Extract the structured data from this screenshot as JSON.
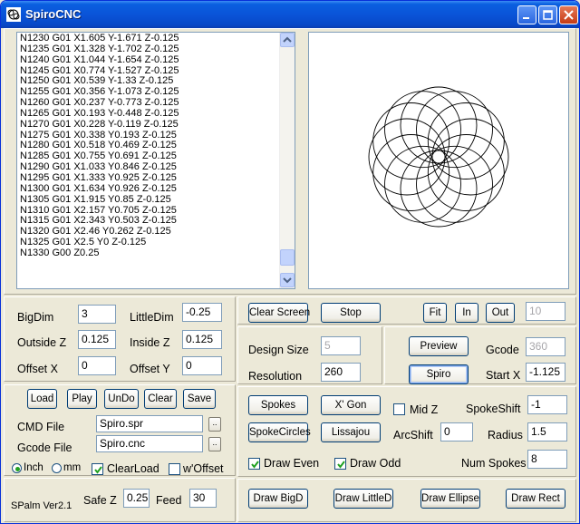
{
  "window": {
    "title": "SpiroCNC"
  },
  "gcode_lines": [
    "N1230 G01 X1.605 Y-1.671 Z-0.125",
    "N1235 G01 X1.328 Y-1.702 Z-0.125",
    "N1240 G01 X1.044 Y-1.654 Z-0.125",
    "N1245 G01 X0.774 Y-1.527 Z-0.125",
    "N1250 G01 X0.539 Y-1.33 Z-0.125",
    "N1255 G01 X0.356 Y-1.073 Z-0.125",
    "N1260 G01 X0.237 Y-0.773 Z-0.125",
    "N1265 G01 X0.193 Y-0.448 Z-0.125",
    "N1270 G01 X0.228 Y-0.119 Z-0.125",
    "N1275 G01 X0.338 Y0.193 Z-0.125",
    "N1280 G01 X0.518 Y0.469 Z-0.125",
    "N1285 G01 X0.755 Y0.691 Z-0.125",
    "N1290 G01 X1.033 Y0.846 Z-0.125",
    "N1295 G01 X1.333 Y0.925 Z-0.125",
    "N1300 G01 X1.634 Y0.926 Z-0.125",
    "N1305 G01 X1.915 Y0.85 Z-0.125",
    "N1310 G01 X2.157 Y0.705 Z-0.125",
    "N1315 G01 X2.343 Y0.503 Z-0.125",
    "N1320 G01 X2.46 Y0.262 Z-0.125",
    "N1325 G01 X2.5 Y0 Z-0.125",
    "N1330 G00 Z0.25"
  ],
  "dims": {
    "bigdim_label": "BigDim",
    "bigdim_value": "3",
    "littledim_label": "LittleDim",
    "littledim_value": "-0.25",
    "outsidez_label": "Outside Z",
    "outsidez_value": "0.125",
    "insidez_label": "Inside Z",
    "insidez_value": "0.125",
    "offsetx_label": "Offset X",
    "offsetx_value": "0",
    "offsety_label": "Offset Y",
    "offsety_value": "0"
  },
  "file_panel": {
    "load": "Load",
    "play": "Play",
    "undo": "UnDo",
    "clear": "Clear",
    "save": "Save",
    "cmd_file_label": "CMD File",
    "cmd_file_value": "Spiro.spr",
    "gcode_file_label": "Gcode File",
    "gcode_file_value": "Spiro.cnc",
    "browse": "..",
    "inch": "Inch",
    "mm": "mm",
    "clearload": "ClearLoad",
    "woffset": "w'Offset",
    "units_selected": "Inch"
  },
  "status": {
    "version": "SPalm Ver2.1",
    "safez_label": "Safe Z",
    "safez_value": "0.25",
    "feed_label": "Feed",
    "feed_value": "30"
  },
  "toolbar": {
    "clear_screen": "Clear Screen",
    "stop": "Stop",
    "fit": "Fit",
    "in": "In",
    "out": "Out",
    "zoom_value": "10"
  },
  "design": {
    "design_size_label": "Design Size",
    "design_size_value": "5",
    "resolution_label": "Resolution",
    "resolution_value": "260",
    "preview": "Preview",
    "spiro": "Spiro",
    "gcode_label": "Gcode",
    "gcode_value": "360",
    "startx_label": "Start X",
    "startx_value": "-1.125"
  },
  "shapes": {
    "spokes": "Spokes",
    "xgon": "X' Gon",
    "midz": "Mid Z",
    "spokeshift_label": "SpokeShift",
    "spokeshift_value": "-1",
    "spokecircles": "SpokeCircles",
    "lissajou": "Lissajou",
    "arcshift_label": "ArcShift",
    "arcshift_value": "0",
    "radius_label": "Radius",
    "radius_value": "1.5",
    "draw_even": "Draw Even",
    "draw_odd": "Draw Odd",
    "numspokes_label": "Num Spokes",
    "numspokes_value": "8"
  },
  "draw_buttons": {
    "bigd": "Draw BigD",
    "littled": "Draw LittleD",
    "ellipse": "Draw Ellipse",
    "rect": "Draw Rect"
  },
  "colors": {
    "title_blue": "#0a54d8",
    "face": "#ece9d8",
    "border_blue": "#7f9db9"
  },
  "drawing": {
    "circle_count": 12,
    "circle_radius": 1.5,
    "center_radius": 1.25
  }
}
